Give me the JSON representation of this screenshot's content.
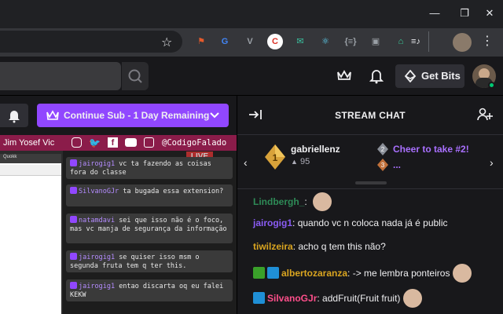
{
  "browser": {
    "extensions": [
      {
        "name": "extension-red-icon",
        "color": "#e55a2b",
        "glyph": "⚑"
      },
      {
        "name": "google-translate-icon",
        "color": "#4285f4",
        "glyph": "G"
      },
      {
        "name": "vue-devtools-icon",
        "color": "#9aa0a6",
        "glyph": "V"
      },
      {
        "name": "extension-c-icon",
        "color": "#ffffff",
        "glyph": "C"
      },
      {
        "name": "mail-icon",
        "color": "#3ac2a0",
        "glyph": "✉"
      },
      {
        "name": "react-devtools-icon",
        "color": "#61dafb",
        "glyph": "⚛"
      },
      {
        "name": "code-icon",
        "color": "#9aa0a6",
        "glyph": "{≡}"
      },
      {
        "name": "picture-in-picture-icon",
        "color": "#9aa0a6",
        "glyph": "▣"
      },
      {
        "name": "extension-bag-icon",
        "color": "#3ad6a0",
        "glyph": "⌂"
      },
      {
        "name": "media-queue-icon",
        "color": "#e8eaed",
        "glyph": "≡♪"
      }
    ]
  },
  "header": {
    "get_bits_label": "Get Bits"
  },
  "stream": {
    "continue_sub_label": "Continue Sub - 1 Day Remaining",
    "social_names": "Jim Yosef  Vic",
    "social_handle": "@CodigoFalado",
    "live_badge": "LIVE",
    "ide_tab": "Quokk"
  },
  "overlay_chat": [
    {
      "user": "jairogig1",
      "text": "vc ta fazendo as coisas fora do classe"
    },
    {
      "user": "SilvanoGJr",
      "text": "ta bugada essa extension?"
    },
    {
      "user": "natamdavi",
      "text": "sei que isso não é o foco, mas vc manja de segurança da informação"
    },
    {
      "user": "jairogig1",
      "text": "se quiser isso msm o segunda fruta tem q ter this."
    },
    {
      "user": "jairogig1",
      "text": "entao discarta oq eu falei KEKW"
    }
  ],
  "chat": {
    "title": "STREAM CHAT",
    "leaderboard": {
      "first_name": "gabriellenz",
      "first_count": "95",
      "cheer_text": "Cheer to take #2!",
      "ellipsis": "..."
    },
    "messages": [
      {
        "user": "Lindbergh_",
        "color": "#2e8b57",
        "text": "",
        "emote": true,
        "badges": []
      },
      {
        "user": "jairogig1",
        "color": "#8a5cf5",
        "text": "quando vc n coloca nada já é public",
        "emote": false,
        "badges": []
      },
      {
        "user": "tiwilzeira",
        "color": "#daa520",
        "text": "acho q tem this não?",
        "emote": false,
        "badges": []
      },
      {
        "user": "albertozaranza",
        "color": "#daa520",
        "text": "-> me lembra ponteiros",
        "emote": true,
        "badges": [
          "gold",
          "blue"
        ]
      },
      {
        "user": "SilvanoGJr",
        "color": "#ff4f8b",
        "text": "addFruit(Fruit fruit)",
        "emote": true,
        "badges": [
          "blue"
        ]
      }
    ]
  },
  "colors": {
    "twitch_purple": "#9147ff",
    "live_red": "#dd3333"
  }
}
